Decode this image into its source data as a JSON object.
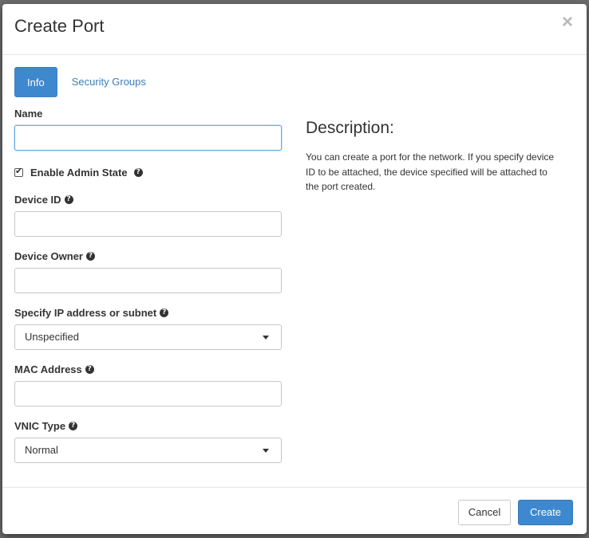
{
  "modal": {
    "title": "Create Port",
    "close_glyph": "×"
  },
  "tabs": [
    {
      "label": "Info",
      "active": true
    },
    {
      "label": "Security Groups",
      "active": false
    }
  ],
  "form": {
    "name": {
      "label": "Name",
      "value": ""
    },
    "admin_state": {
      "label": "Enable Admin State",
      "checked": true
    },
    "device_id": {
      "label": "Device ID",
      "value": ""
    },
    "device_owner": {
      "label": "Device Owner",
      "value": ""
    },
    "ip_subnet": {
      "label": "Specify IP address or subnet",
      "selected": "Unspecified"
    },
    "mac_address": {
      "label": "MAC Address",
      "value": ""
    },
    "vnic_type": {
      "label": "VNIC Type",
      "selected": "Normal"
    }
  },
  "description": {
    "heading": "Description:",
    "text": "You can create a port for the network. If you specify device ID to be attached, the device specified will be attached to the port created."
  },
  "footer": {
    "cancel_label": "Cancel",
    "create_label": "Create"
  },
  "icons": {
    "help": "question-circle-icon",
    "check": "check-icon",
    "close": "close-icon",
    "caret": "caret-down-icon"
  },
  "colors": {
    "primary": "#3e88cf",
    "link": "#3a7dbf",
    "focus_border": "#66afe9"
  }
}
